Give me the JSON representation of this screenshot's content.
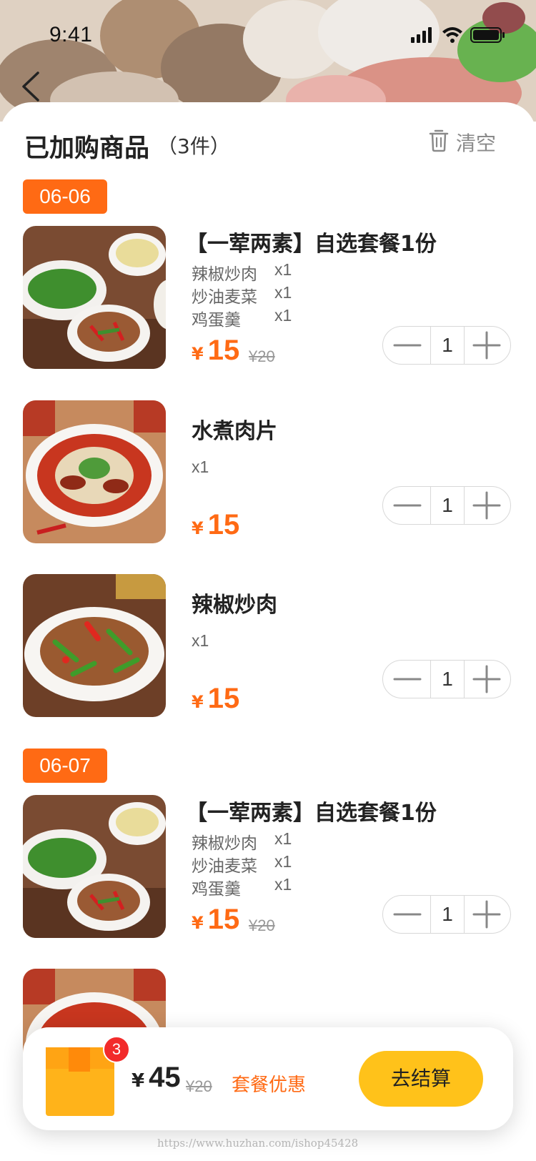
{
  "status_bar": {
    "time": "9:41"
  },
  "header": {
    "title": "已加购商品",
    "count": "（3件）",
    "clear_label": "清空"
  },
  "colors": {
    "accent": "#ff6a14",
    "checkout": "#ffc21a",
    "badge": "#f22b2b"
  },
  "groups": [
    {
      "date": "06-06",
      "items": [
        {
          "name": "【一荤两素】自选套餐1份",
          "details": [
            {
              "label": "辣椒炒肉",
              "qty": "x1"
            },
            {
              "label": "炒油麦菜",
              "qty": "x1"
            },
            {
              "label": "鸡蛋羹",
              "qty": "x1"
            }
          ],
          "price_symbol": "¥",
          "price": "15",
          "original_price": "¥20",
          "quantity": "1"
        },
        {
          "name": "水煮肉片",
          "qty_label": "x1",
          "price_symbol": "¥",
          "price": "15",
          "quantity": "1"
        },
        {
          "name": "辣椒炒肉",
          "qty_label": "x1",
          "price_symbol": "¥",
          "price": "15",
          "quantity": "1"
        }
      ]
    },
    {
      "date": "06-07",
      "items": [
        {
          "name": "【一荤两素】自选套餐1份",
          "details": [
            {
              "label": "辣椒炒肉",
              "qty": "x1"
            },
            {
              "label": "炒油麦菜",
              "qty": "x1"
            },
            {
              "label": "鸡蛋羹",
              "qty": "x1"
            }
          ],
          "price_symbol": "¥",
          "price": "15",
          "original_price": "¥20",
          "quantity": "1"
        }
      ]
    }
  ],
  "cart": {
    "badge_count": "3",
    "total_symbol": "¥",
    "total": "45",
    "original_total": "¥20",
    "discount_label": "套餐优惠",
    "checkout_label": "去结算"
  },
  "watermark": "https://www.huzhan.com/ishop45428"
}
